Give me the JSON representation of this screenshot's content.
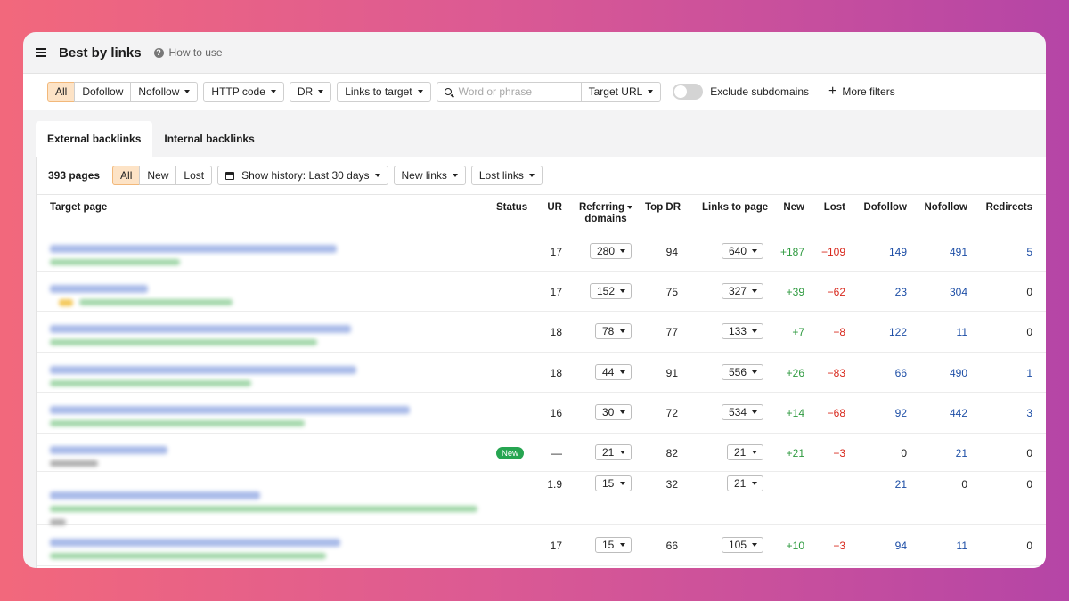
{
  "header": {
    "title": "Best by links",
    "help_label": "How to use"
  },
  "filters": {
    "link_type": [
      "All",
      "Dofollow",
      "Nofollow"
    ],
    "http_code": "HTTP code",
    "dr": "DR",
    "links_to_target": "Links to target",
    "search_placeholder": "Word or phrase",
    "target_url": "Target URL",
    "exclude_subdomains": "Exclude subdomains",
    "more_filters": "More filters"
  },
  "tabs": [
    "External backlinks",
    "Internal backlinks"
  ],
  "toolbar": {
    "pages_count": "393 pages",
    "status_filter": [
      "All",
      "New",
      "Lost"
    ],
    "history": "Show history: Last 30 days",
    "new_links": "New links",
    "lost_links": "Lost links"
  },
  "columns": {
    "target_page": "Target page",
    "status": "Status",
    "ur": "UR",
    "referring_domains_1": "Referring",
    "referring_domains_2": "domains",
    "top_dr": "Top DR",
    "links_to_page": "Links to page",
    "new": "New",
    "lost": "Lost",
    "dofollow": "Dofollow",
    "nofollow": "Nofollow",
    "redirects": "Redirects"
  },
  "rows": [
    {
      "status": "",
      "ur": "17",
      "ref_domains": "280",
      "top_dr": "94",
      "links_to_page": "640",
      "new": "+187",
      "lost": "−109",
      "dofollow": "149",
      "nofollow": "491",
      "redirects": "5"
    },
    {
      "status": "",
      "ur": "17",
      "ref_domains": "152",
      "top_dr": "75",
      "links_to_page": "327",
      "new": "+39",
      "lost": "−62",
      "dofollow": "23",
      "nofollow": "304",
      "redirects": "0"
    },
    {
      "status": "",
      "ur": "18",
      "ref_domains": "78",
      "top_dr": "77",
      "links_to_page": "133",
      "new": "+7",
      "lost": "−8",
      "dofollow": "122",
      "nofollow": "11",
      "redirects": "0"
    },
    {
      "status": "",
      "ur": "18",
      "ref_domains": "44",
      "top_dr": "91",
      "links_to_page": "556",
      "new": "+26",
      "lost": "−83",
      "dofollow": "66",
      "nofollow": "490",
      "redirects": "1"
    },
    {
      "status": "",
      "ur": "16",
      "ref_domains": "30",
      "top_dr": "72",
      "links_to_page": "534",
      "new": "+14",
      "lost": "−68",
      "dofollow": "92",
      "nofollow": "442",
      "redirects": "3"
    },
    {
      "status": "New",
      "ur": "—",
      "ref_domains": "21",
      "top_dr": "82",
      "links_to_page": "21",
      "new": "+21",
      "lost": "−3",
      "dofollow": "0",
      "nofollow": "21",
      "redirects": "0"
    },
    {
      "status": "",
      "ur": "1.9",
      "ref_domains": "15",
      "top_dr": "32",
      "links_to_page": "21",
      "new": "",
      "lost": "",
      "dofollow": "21",
      "nofollow": "0",
      "redirects": "0"
    },
    {
      "status": "",
      "ur": "17",
      "ref_domains": "15",
      "top_dr": "66",
      "links_to_page": "105",
      "new": "+10",
      "lost": "−3",
      "dofollow": "94",
      "nofollow": "11",
      "redirects": "0"
    }
  ],
  "colors": {
    "background_left": "#f2687c",
    "background_right": "#b545a6",
    "active_filter": "#fde3c6",
    "link_blue": "#1d4ea6",
    "positive_green": "#2e9a3f",
    "negative_red": "#d8281c",
    "new_badge": "#26a551"
  },
  "icons": [
    "menu-icon",
    "help-icon",
    "caret-down-icon",
    "search-icon",
    "calendar-icon",
    "plus-icon",
    "toggle-switch"
  ]
}
